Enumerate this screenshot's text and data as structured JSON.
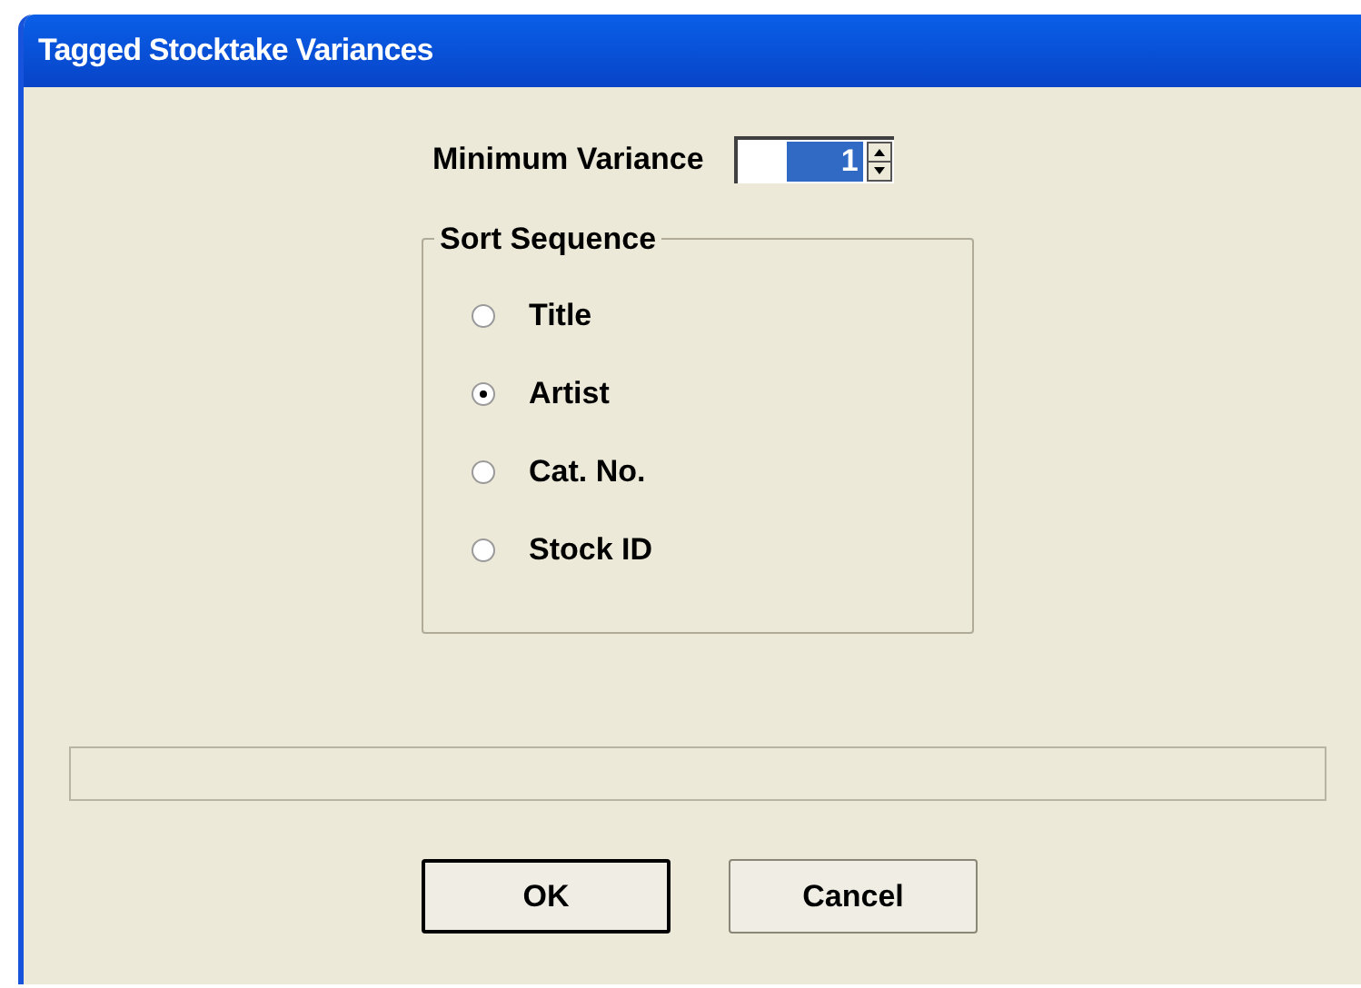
{
  "window": {
    "title": "Tagged Stocktake Variances"
  },
  "minimum_variance": {
    "label": "Minimum Variance",
    "value": "1",
    "selected": true
  },
  "sort_sequence": {
    "label": "Sort Sequence",
    "options": [
      {
        "label": "Title",
        "selected": false
      },
      {
        "label": "Artist",
        "selected": true
      },
      {
        "label": "Cat. No.",
        "selected": false
      },
      {
        "label": "Stock ID",
        "selected": false
      }
    ]
  },
  "progress": {
    "level": 0
  },
  "buttons": [
    {
      "label": "OK",
      "default": true
    },
    {
      "label": "Cancel",
      "default": false
    }
  ]
}
